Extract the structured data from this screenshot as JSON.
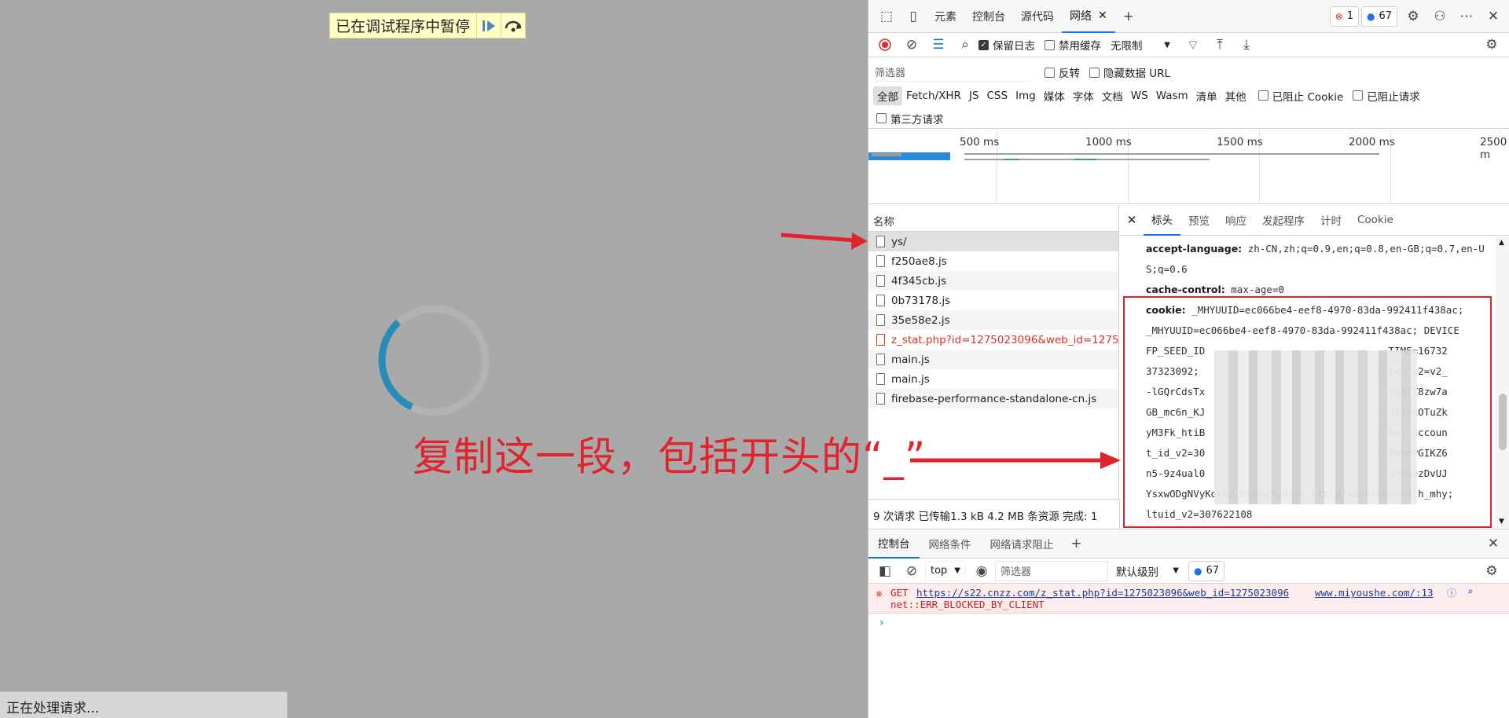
{
  "page": {
    "paused_text": "已在调试程序中暂停",
    "status_text": "正在处理请求...",
    "annotation_text": "复制这一段，包括开头的“_”"
  },
  "devtools": {
    "tabs": [
      "元素",
      "控制台",
      "源代码",
      "网络"
    ],
    "active_tab": "网络",
    "error_count": "1",
    "message_count": "67",
    "toolbar": {
      "preserve_log": "保留日志",
      "disable_cache": "禁用缓存",
      "throttle": "无限制"
    },
    "filter": {
      "placeholder": "筛选器",
      "invert": "反转",
      "hide_data_urls": "隐藏数据 URL",
      "third_party": "第三方请求"
    },
    "types": [
      "全部",
      "Fetch/XHR",
      "JS",
      "CSS",
      "Img",
      "媒体",
      "字体",
      "文档",
      "WS",
      "Wasm",
      "清单",
      "其他"
    ],
    "blocked_cookies": "已阻止 Cookie",
    "blocked_requests": "已阻止请求",
    "timeline_ticks": [
      "500 ms",
      "1000 ms",
      "1500 ms",
      "2000 ms",
      "2500 m"
    ],
    "name_header": "名称",
    "requests": [
      {
        "name": "ys/",
        "selected": true,
        "error": false
      },
      {
        "name": "f250ae8.js",
        "selected": false,
        "error": false
      },
      {
        "name": "4f345cb.js",
        "selected": false,
        "error": false
      },
      {
        "name": "0b73178.js",
        "selected": false,
        "error": false
      },
      {
        "name": "35e58e2.js",
        "selected": false,
        "error": false
      },
      {
        "name": "z_stat.php?id=1275023096&web_id=1275...",
        "selected": false,
        "error": true
      },
      {
        "name": "main.js",
        "selected": false,
        "error": false
      },
      {
        "name": "main.js",
        "selected": false,
        "error": false
      },
      {
        "name": "firebase-performance-standalone-cn.js",
        "selected": false,
        "error": false
      }
    ],
    "summary": "9 次请求  已传输1.3 kB  4.2 MB 条资源  完成: 1",
    "detail_tabs": [
      "标头",
      "预览",
      "响应",
      "发起程序",
      "计时",
      "Cookie"
    ],
    "headers": {
      "accept_language_name": "accept-language:",
      "accept_language_value": "zh-CN,zh;q=0.9,en;q=0.8,en-GB;q=0.7,en-US;q=0.6",
      "cache_control_name": "cache-control:",
      "cache_control_value": "max-age=0",
      "cookie_name": "cookie:",
      "cookie_lines": [
        " _MHYUUID=ec066be4-eef8-4970-83da-992411f438ac;",
        "_MHYUUID=ec066be4-eef8-4970-83da-992411f438ac; DEVICE",
        "FP_SEED_ID                               TIME=16732",
        "37323092;                                ken_v2=v2_",
        "-lGQrCdsTx                               fq8TT8zw7a",
        "GB_mc6n_KJ                               66JfkOTuZk",
        "yM3Fk_htiB                               hy; accoun",
        "t_id_v2=30                               8vSPPGIKZ6",
        "n5-9z4ual0                               dNKg9zDvUJ",
        "YsxwODgNVyKdrh2cEkoFp7gQ==; ltmid_v2=0tubhwo4lh_mhy;",
        "ltuid_v2=307622108"
      ]
    },
    "console": {
      "tabs": [
        "控制台",
        "网络条件",
        "网络请求阻止"
      ],
      "context": "top",
      "filter_placeholder": "筛选器",
      "level": "默认级别",
      "message_count": "67",
      "error_method": "GET",
      "error_url": "https://s22.cnzz.com/z_stat.php?id=1275023096&web_id=1275023096",
      "error_source": "www.miyoushe.com/:13",
      "error_text": "net::ERR_BLOCKED_BY_CLIENT"
    }
  },
  "colors": {
    "annotation": "#e0242d",
    "accent": "#1a73e8",
    "error": "#d93025",
    "page_bg": "#a9a9a9"
  }
}
